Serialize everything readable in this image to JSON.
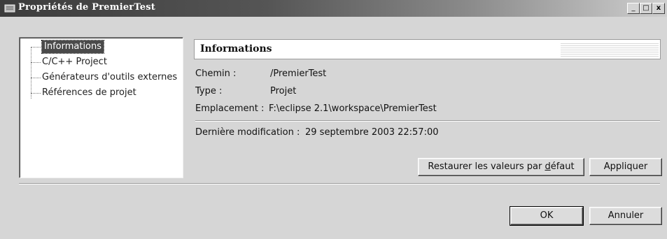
{
  "window": {
    "title": "Propriétés de PremierTest",
    "controls": {
      "minimize": "_",
      "maximize": "□",
      "close": "x"
    }
  },
  "tree": {
    "items": [
      {
        "label": "Informations",
        "selected": true
      },
      {
        "label": "C/C++ Project",
        "selected": false
      },
      {
        "label": "Générateurs d'outils externes",
        "selected": false
      },
      {
        "label": "Références de projet",
        "selected": false
      }
    ]
  },
  "page": {
    "header_title": "Informations",
    "fields": [
      {
        "label": "Chemin :",
        "value": "/PremierTest"
      },
      {
        "label": "Type :",
        "value": "Projet"
      },
      {
        "label": "Emplacement :",
        "value": "F:\\eclipse 2.1\\workspace\\PremierTest"
      }
    ],
    "last_modified": {
      "label": "Dernière modification :",
      "value": "29 septembre 2003 22:57:00"
    },
    "restore_button": {
      "pre": "Restaurer les valeurs par ",
      "mnemonic": "d",
      "post": "éfaut"
    },
    "apply_button": "Appliquer"
  },
  "footer": {
    "ok_button": "OK",
    "cancel_button": "Annuler"
  },
  "colors": {
    "dialog_bg": "#d6d6d6",
    "selection_bg": "#4a4a4a",
    "titlebar_start": "#3c3c3c"
  },
  "icons": [
    "app-icon",
    "minimize-icon",
    "maximize-icon",
    "close-icon"
  ]
}
